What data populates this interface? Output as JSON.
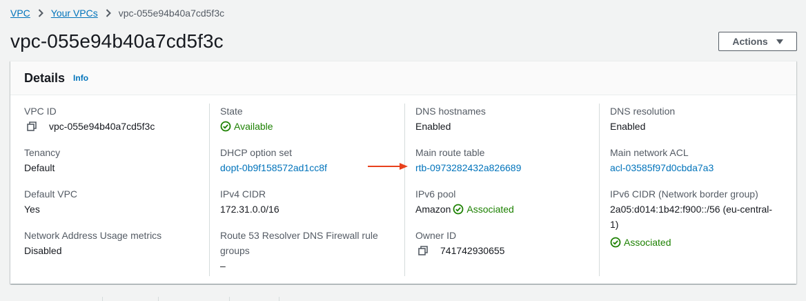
{
  "breadcrumb": {
    "items": [
      "VPC",
      "Your VPCs"
    ],
    "current": "vpc-055e94b40a7cd5f3c"
  },
  "page": {
    "title": "vpc-055e94b40a7cd5f3c",
    "actions_label": "Actions"
  },
  "details": {
    "title": "Details",
    "info_label": "Info",
    "vpc_id": {
      "label": "VPC ID",
      "value": "vpc-055e94b40a7cd5f3c"
    },
    "tenancy": {
      "label": "Tenancy",
      "value": "Default"
    },
    "default_vpc": {
      "label": "Default VPC",
      "value": "Yes"
    },
    "nau_metrics": {
      "label": "Network Address Usage metrics",
      "value": "Disabled"
    },
    "state": {
      "label": "State",
      "value": "Available"
    },
    "dhcp": {
      "label": "DHCP option set",
      "value": "dopt-0b9f158572ad1cc8f"
    },
    "ipv4_cidr": {
      "label": "IPv4 CIDR",
      "value": "172.31.0.0/16"
    },
    "route53_fw": {
      "label_line1": "Route 53 Resolver DNS Firewall rule",
      "label_line2": "groups",
      "value": "–"
    },
    "dns_hostnames": {
      "label": "DNS hostnames",
      "value": "Enabled"
    },
    "main_route_table": {
      "label": "Main route table",
      "value": "rtb-0973282432a826689"
    },
    "ipv6_pool": {
      "label": "IPv6 pool",
      "value": "Amazon",
      "status": "Associated"
    },
    "owner_id": {
      "label": "Owner ID",
      "value": "741742930655"
    },
    "dns_resolution": {
      "label": "DNS resolution",
      "value": "Enabled"
    },
    "main_acl": {
      "label": "Main network ACL",
      "value": "acl-03585f97d0cbda7a3"
    },
    "ipv6_cidr": {
      "label": "IPv6 CIDR (Network border group)",
      "value_line1": "2a05:d014:1b42:f900::/56 (eu-central-",
      "value_line2": "1)",
      "status": "Associated"
    }
  },
  "colors": {
    "link": "#0073bb",
    "success": "#1d8102",
    "annotation_arrow": "#e8401c",
    "label": "#545b64"
  },
  "icons": {
    "breadcrumb_separator": "chevron-right-icon",
    "actions_caret": "caret-down-icon",
    "copy": "copy-icon",
    "status_ok": "status-positive-icon",
    "annotation": "red-arrow"
  }
}
